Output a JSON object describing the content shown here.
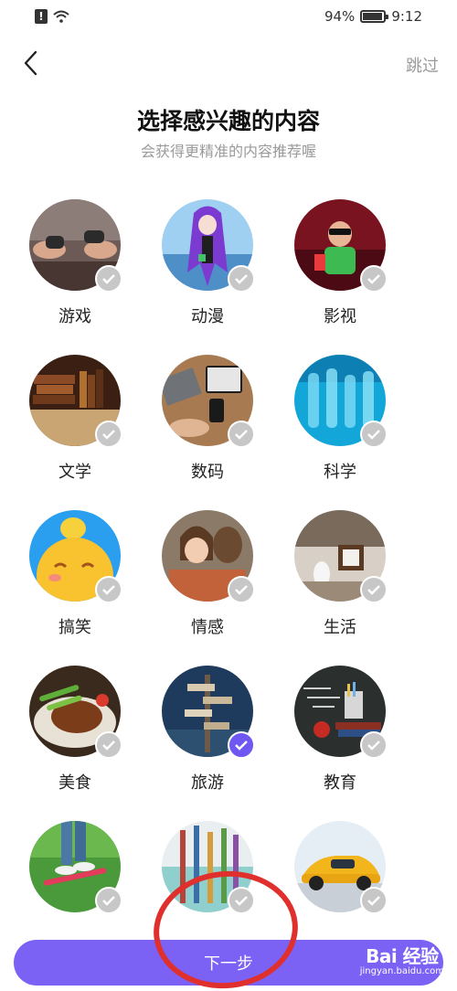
{
  "status_bar": {
    "battery": "94%",
    "time": "9:12"
  },
  "header": {
    "skip_label": "跳过"
  },
  "intro": {
    "title": "选择感兴趣的内容",
    "subtitle": "会获得更精准的内容推荐喔"
  },
  "categories": [
    {
      "label": "游戏",
      "selected": false,
      "image_icon": "game-controller-photo"
    },
    {
      "label": "动漫",
      "selected": false,
      "image_icon": "anime-character-photo"
    },
    {
      "label": "影视",
      "selected": false,
      "image_icon": "cinema-viewer-photo"
    },
    {
      "label": "文学",
      "selected": false,
      "image_icon": "books-photo"
    },
    {
      "label": "数码",
      "selected": false,
      "image_icon": "laptop-tablet-photo"
    },
    {
      "label": "科学",
      "selected": false,
      "image_icon": "lab-glassware-photo"
    },
    {
      "label": "搞笑",
      "selected": false,
      "image_icon": "laughing-emoji-photo"
    },
    {
      "label": "情感",
      "selected": false,
      "image_icon": "couple-hug-photo"
    },
    {
      "label": "生活",
      "selected": false,
      "image_icon": "living-room-photo"
    },
    {
      "label": "美食",
      "selected": false,
      "image_icon": "steak-dish-photo"
    },
    {
      "label": "旅游",
      "selected": true,
      "image_icon": "signpost-photo"
    },
    {
      "label": "教育",
      "selected": false,
      "image_icon": "blackboard-books-photo"
    },
    {
      "label": "",
      "selected": false,
      "image_icon": "skateboard-photo"
    },
    {
      "label": "",
      "selected": false,
      "image_icon": "paintbrushes-photo"
    },
    {
      "label": "",
      "selected": false,
      "image_icon": "sports-car-photo"
    }
  ],
  "footer": {
    "next_label": "下一步",
    "watermark_main": "Bai  经验",
    "watermark_sub": "jingyan.baidu.com"
  },
  "colors": {
    "accent": "#7b62f5",
    "check_selected": "#6f58f2",
    "check_unselected": "#c7c7c7",
    "annotation": "#e0302e"
  }
}
